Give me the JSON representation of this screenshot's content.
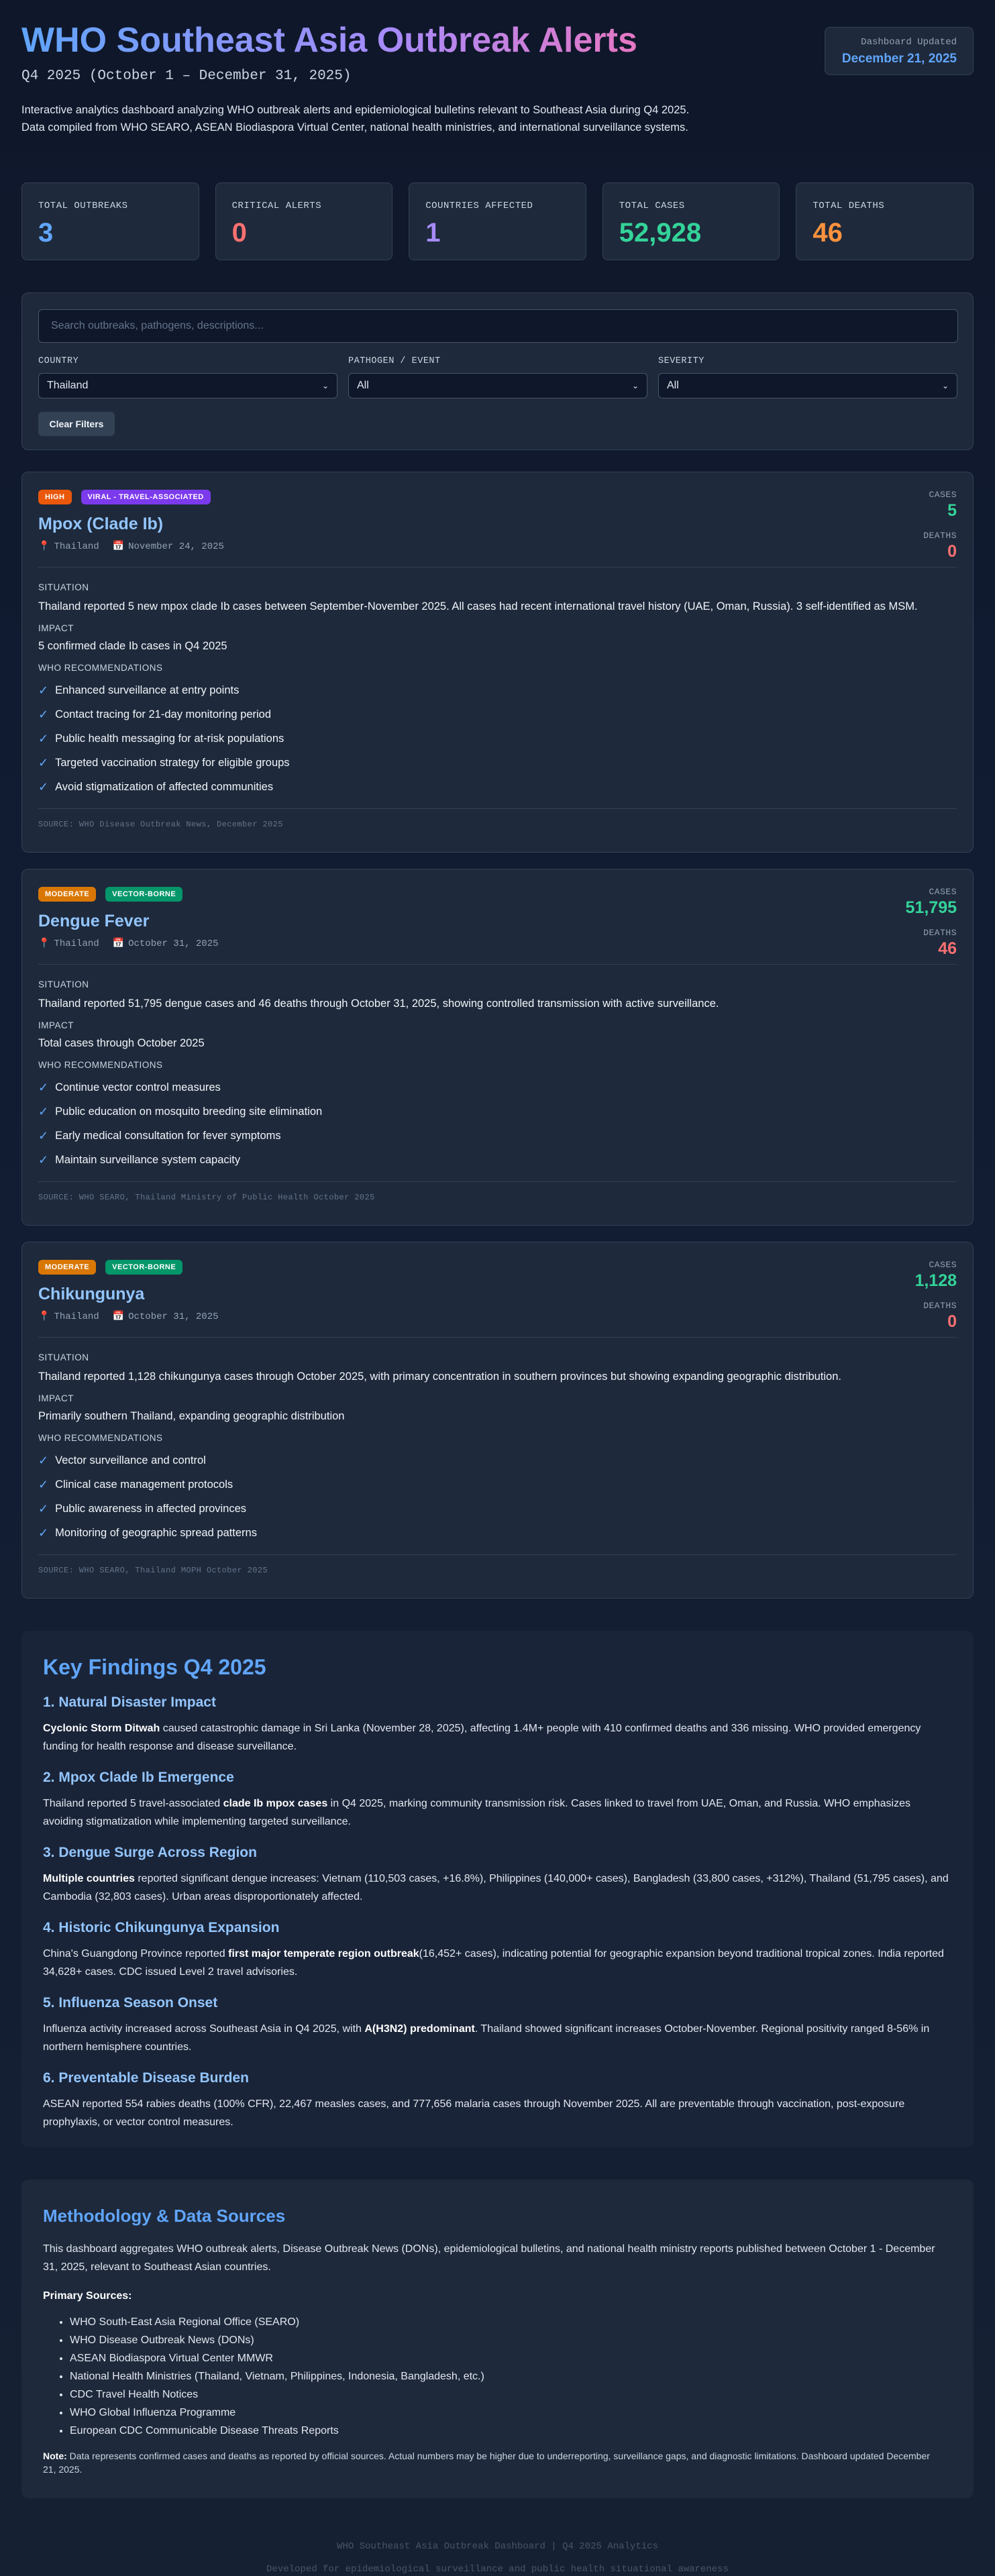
{
  "header": {
    "title": "WHO Southeast Asia Outbreak Alerts",
    "subtitle": "Q4 2025 (October 1 – December 31, 2025)",
    "description": "Interactive analytics dashboard analyzing WHO outbreak alerts and epidemiological bulletins relevant to Southeast Asia during Q4 2025. Data compiled from WHO SEARO, ASEAN Biodiaspora Virtual Center, national health ministries, and international surveillance systems.",
    "updated_label": "Dashboard Updated",
    "updated_value": "December 21, 2025"
  },
  "stats": [
    {
      "label": "TOTAL OUTBREAKS",
      "value": "3",
      "color": "#60a5fa"
    },
    {
      "label": "CRITICAL ALERTS",
      "value": "0",
      "color": "#f87171"
    },
    {
      "label": "COUNTRIES AFFECTED",
      "value": "1",
      "color": "#a78bfa"
    },
    {
      "label": "TOTAL CASES",
      "value": "52,928",
      "color": "#34d399"
    },
    {
      "label": "TOTAL DEATHS",
      "value": "46",
      "color": "#fb923c"
    }
  ],
  "filters": {
    "search_placeholder": "Search outbreaks, pathogens, descriptions...",
    "country_label": "COUNTRY",
    "country_value": "Thailand",
    "pathogen_label": "PATHOGEN / EVENT",
    "pathogen_value": "All",
    "severity_label": "SEVERITY",
    "severity_value": "All",
    "clear_label": "Clear Filters"
  },
  "labels": {
    "cases": "CASES",
    "deaths": "DEATHS",
    "situation": "SITUATION",
    "impact": "IMPACT",
    "recommendations": "WHO RECOMMENDATIONS"
  },
  "cards": [
    {
      "severity": "HIGH",
      "severity_color": "#ea580c",
      "category": "VIRAL - TRAVEL-ASSOCIATED",
      "category_color": "#7c3aed",
      "title": "Mpox (Clade Ib)",
      "location": "Thailand",
      "date": "November 24, 2025",
      "cases": "5",
      "deaths": "0",
      "situation": "Thailand reported 5 new mpox clade Ib cases between September-November 2025. All cases had recent international travel history (UAE, Oman, Russia). 3 self-identified as MSM.",
      "impact": "5 confirmed clade Ib cases in Q4 2025",
      "recommendations": [
        "Enhanced surveillance at entry points",
        "Contact tracing for 21-day monitoring period",
        "Public health messaging for at-risk populations",
        "Targeted vaccination strategy for eligible groups",
        "Avoid stigmatization of affected communities"
      ],
      "source": "SOURCE: WHO Disease Outbreak News, December 2025"
    },
    {
      "severity": "MODERATE",
      "severity_color": "#d97706",
      "category": "VECTOR-BORNE",
      "category_color": "#059669",
      "title": "Dengue Fever",
      "location": "Thailand",
      "date": "October 31, 2025",
      "cases": "51,795",
      "deaths": "46",
      "situation": "Thailand reported 51,795 dengue cases and 46 deaths through October 31, 2025, showing controlled transmission with active surveillance.",
      "impact": "Total cases through October 2025",
      "recommendations": [
        "Continue vector control measures",
        "Public education on mosquito breeding site elimination",
        "Early medical consultation for fever symptoms",
        "Maintain surveillance system capacity"
      ],
      "source": "SOURCE: WHO SEARO, Thailand Ministry of Public Health October 2025"
    },
    {
      "severity": "MODERATE",
      "severity_color": "#d97706",
      "category": "VECTOR-BORNE",
      "category_color": "#059669",
      "title": "Chikungunya",
      "location": "Thailand",
      "date": "October 31, 2025",
      "cases": "1,128",
      "deaths": "0",
      "situation": "Thailand reported 1,128 chikungunya cases through October 2025, with primary concentration in southern provinces but showing expanding geographic distribution.",
      "impact": "Primarily southern Thailand, expanding geographic distribution",
      "recommendations": [
        "Vector surveillance and control",
        "Clinical case management protocols",
        "Public awareness in affected provinces",
        "Monitoring of geographic spread patterns"
      ],
      "source": "SOURCE: WHO SEARO, Thailand MOPH October 2025"
    }
  ],
  "findings": {
    "title": "Key Findings Q4 2025",
    "items": [
      {
        "heading": "1. Natural Disaster Impact",
        "bold": "Cyclonic Storm Ditwah",
        "pre": "",
        "post": " caused catastrophic damage in Sri Lanka (November 28, 2025), affecting 1.4M+ people with 410 confirmed deaths and 336 missing. WHO provided emergency funding for health response and disease surveillance."
      },
      {
        "heading": "2. Mpox Clade Ib Emergence",
        "pre": "Thailand reported 5 travel-associated ",
        "bold": "clade Ib mpox cases",
        "post": " in Q4 2025, marking community transmission risk. Cases linked to travel from UAE, Oman, and Russia. WHO emphasizes avoiding stigmatization while implementing targeted surveillance."
      },
      {
        "heading": "3. Dengue Surge Across Region",
        "pre": "",
        "bold": "Multiple countries",
        "post": " reported significant dengue increases: Vietnam (110,503 cases, +16.8%), Philippines (140,000+ cases), Bangladesh (33,800 cases, +312%), Thailand (51,795 cases), and Cambodia (32,803 cases). Urban areas disproportionately affected."
      },
      {
        "heading": "4. Historic Chikungunya Expansion",
        "pre": "China's Guangdong Province reported ",
        "bold": "first major temperate region outbreak",
        "post": "(16,452+ cases), indicating potential for geographic expansion beyond traditional tropical zones. India reported 34,628+ cases. CDC issued Level 2 travel advisories."
      },
      {
        "heading": "5. Influenza Season Onset",
        "pre": "Influenza activity increased across Southeast Asia in Q4 2025, with ",
        "bold": "A(H3N2) predominant",
        "post": ". Thailand showed significant increases October-November. Regional positivity ranged 8-56% in northern hemisphere countries."
      },
      {
        "heading": "6. Preventable Disease Burden",
        "pre": "ASEAN reported 554 rabies deaths (100% CFR), 22,467 measles cases, and 777,656 malaria cases through November 2025. All are preventable through vaccination, post-exposure prophylaxis, or vector control measures.",
        "bold": "",
        "post": ""
      }
    ]
  },
  "methodology": {
    "title": "Methodology & Data Sources",
    "text": "This dashboard aggregates WHO outbreak alerts, Disease Outbreak News (DONs), epidemiological bulletins, and national health ministry reports published between October 1 - December 31, 2025, relevant to Southeast Asian countries.",
    "sources_label": "Primary Sources:",
    "sources": [
      "WHO South-East Asia Regional Office (SEARO)",
      "WHO Disease Outbreak News (DONs)",
      "ASEAN Biodiaspora Virtual Center MMWR",
      "National Health Ministries (Thailand, Vietnam, Philippines, Indonesia, Bangladesh, etc.)",
      "CDC Travel Health Notices",
      "WHO Global Influenza Programme",
      "European CDC Communicable Disease Threats Reports"
    ],
    "note_label": "Note:",
    "note_text": " Data represents confirmed cases and deaths as reported by official sources. Actual numbers may be higher due to underreporting, surveillance gaps, and diagnostic limitations. Dashboard updated December 21, 2025."
  },
  "footer": {
    "line1": "WHO Southeast Asia Outbreak Dashboard | Q4 2025 Analytics",
    "line2": "Developed for epidemiological surveillance and public health situational awareness"
  }
}
